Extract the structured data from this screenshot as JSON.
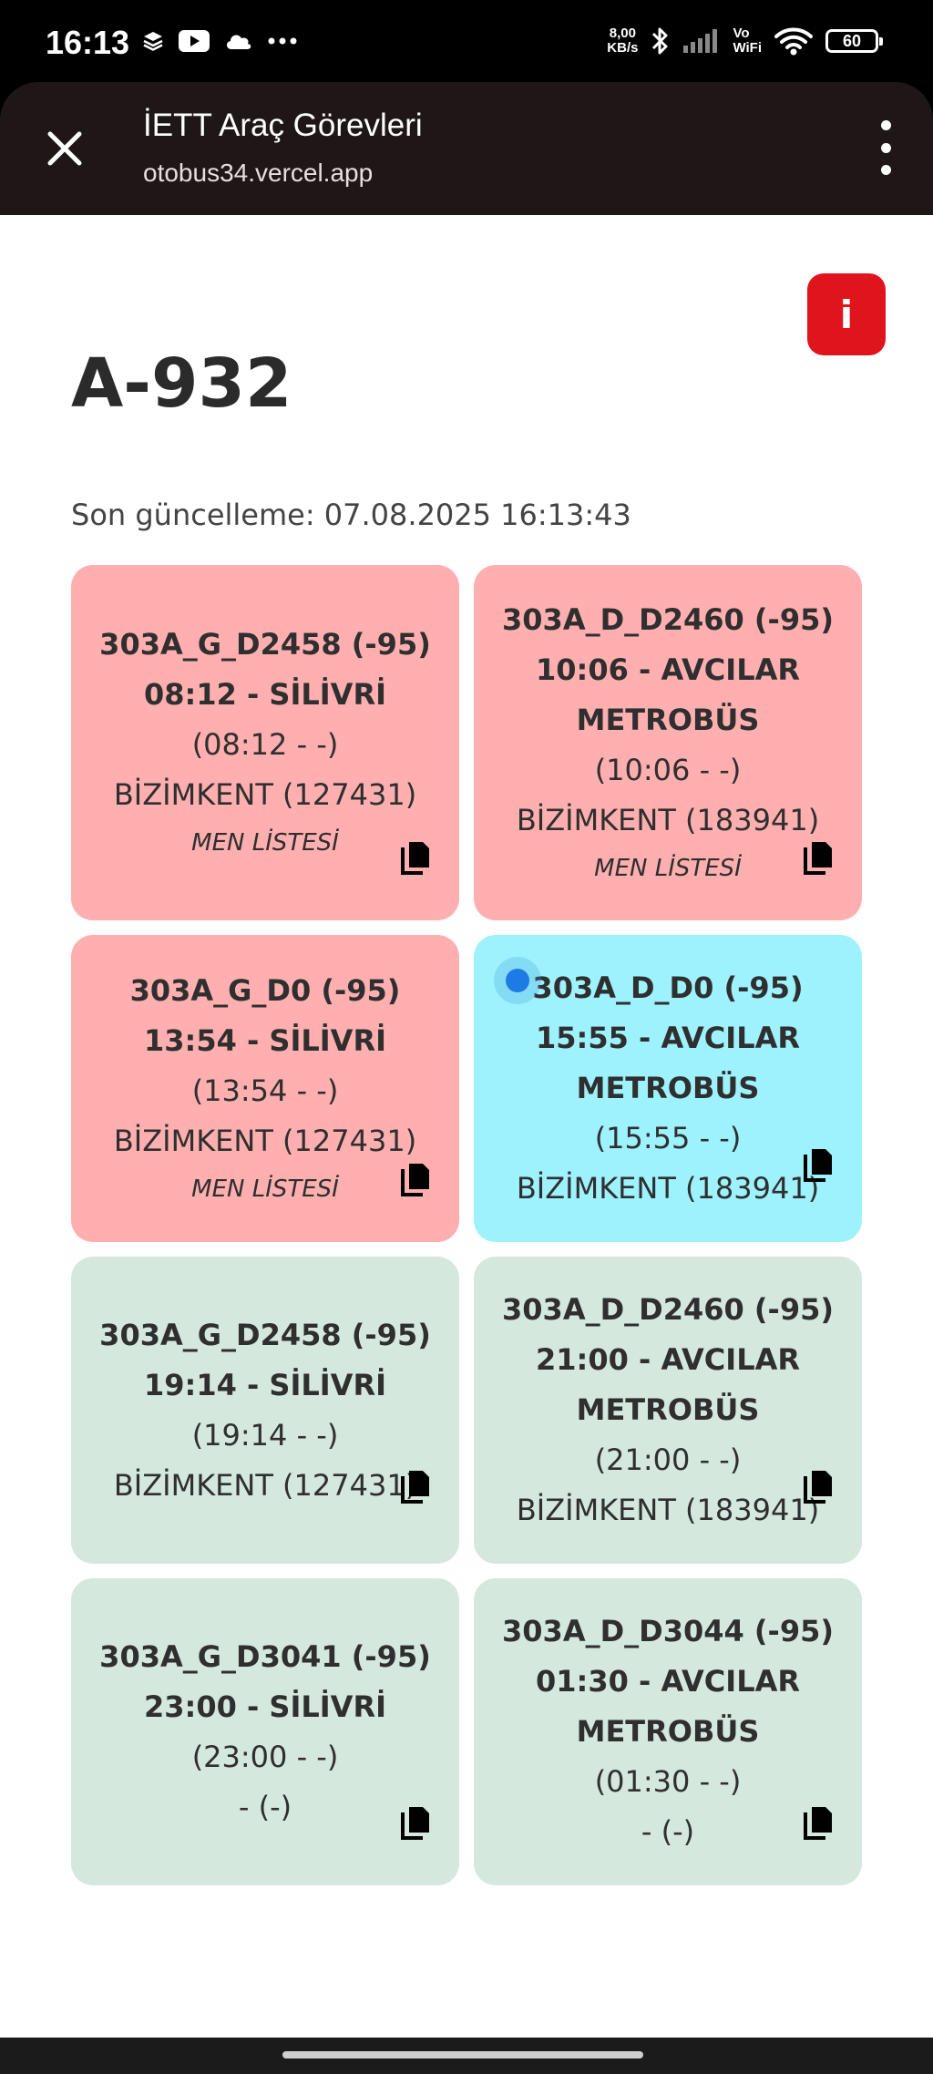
{
  "status_bar": {
    "time": "16:13",
    "speed_value": "8,00",
    "speed_unit": "KB/s",
    "vo": "Vo",
    "wifi": "WiFi",
    "battery": "60"
  },
  "browser": {
    "title": "İETT Araç Görevleri",
    "url": "otobus34.vercel.app"
  },
  "page": {
    "info_label": "i",
    "title": "A-932",
    "last_update": "Son güncelleme: 07.08.2025 16:13:43"
  },
  "cards": [
    {
      "route": "303A_G_D2458 (-95)",
      "time_dest": "08:12 - SİLİVRİ",
      "range": "(08:12 - -)",
      "depot": "BİZİMKENT (127431)",
      "men": "MEN LİSTESİ"
    },
    {
      "route": "303A_D_D2460 (-95)",
      "time_dest": "10:06 - AVCILAR METROBÜS",
      "range": "(10:06 - -)",
      "depot": "BİZİMKENT (183941)",
      "men": "MEN LİSTESİ"
    },
    {
      "route": "303A_G_D0 (-95)",
      "time_dest": "13:54 - SİLİVRİ",
      "range": "(13:54 - -)",
      "depot": "BİZİMKENT (127431)",
      "men": "MEN LİSTESİ"
    },
    {
      "route": "303A_D_D0 (-95)",
      "time_dest": "15:55 - AVCILAR METROBÜS",
      "range": "(15:55 - -)",
      "depot": "BİZİMKENT (183941)",
      "men": ""
    },
    {
      "route": "303A_G_D2458 (-95)",
      "time_dest": "19:14 - SİLİVRİ",
      "range": "(19:14 - -)",
      "depot": "BİZİMKENT (127431)",
      "men": ""
    },
    {
      "route": "303A_D_D2460 (-95)",
      "time_dest": "21:00 - AVCILAR METROBÜS",
      "range": "(21:00 - -)",
      "depot": "BİZİMKENT (183941)",
      "men": ""
    },
    {
      "route": "303A_G_D3041 (-95)",
      "time_dest": "23:00 - SİLİVRİ",
      "range": "(23:00 - -)",
      "depot": "- (-)",
      "men": ""
    },
    {
      "route": "303A_D_D3044 (-95)",
      "time_dest": "01:30 - AVCILAR METROBÜS",
      "range": "(01:30 - -)",
      "depot": "- (-)",
      "men": ""
    }
  ],
  "colors": {
    "past": "#ffafaf",
    "current": "#9df2fd",
    "upcoming": "#d5e8dd",
    "info_button": "#e0141c",
    "live_dot": "#1e7be6"
  },
  "icons": {
    "close": "close-icon",
    "menu": "more-vert-icon",
    "copy": "copy-icon",
    "info": "info-icon"
  }
}
